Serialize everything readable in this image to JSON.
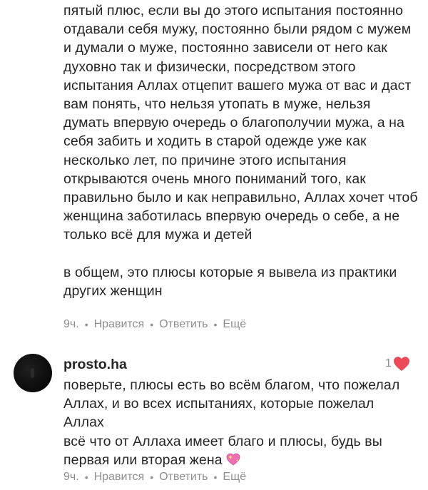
{
  "comment1": {
    "paragraph1": "пятый плюс, если вы до этого испытания постоянно отдавали себя мужу, постоянно были рядом с мужем и думали о муже, постоянно зависели от него как духовно так и физически, посредством этого испытания Аллах отцепит вашего мужа от вас и даст вам понять, что нельзя утопать в муже, нельзя думать впервую очередь о благополучии мужа, а на себя забить и ходить в старой одежде уже как несколько лет, по причине этого испытания открываются очень много пониманий того, как правильно было и как неправильно, Аллах хочет чтоб женщина заботилась впервую очередь о себе, а не только всё для мужа и детей",
    "paragraph2": "в общем, это плюсы которые я вывела из практики других женщин",
    "time": "9ч.",
    "like_action": "Нравится",
    "reply_action": "Ответить",
    "more_action": "Ещё"
  },
  "comment2": {
    "username": "prosto.ha",
    "like_count": "1",
    "paragraph1": "поверьте, плюсы есть во всём благом, что пожелал Аллах, и во всех испытаниях, которые пожелал Аллах",
    "paragraph2": "всё что от Аллаха имеет благо и плюсы, будь вы первая или вторая жена",
    "time": "9ч.",
    "like_action": "Нравится",
    "reply_action": "Ответить",
    "more_action": "Ещё"
  },
  "colors": {
    "text": "#262626",
    "meta": "#8e8e8e",
    "heart": "#ed4956",
    "background": "#ffffff"
  },
  "icons": {
    "like_heart": "heart-icon",
    "emoji": "sparkling-heart-emoji"
  }
}
